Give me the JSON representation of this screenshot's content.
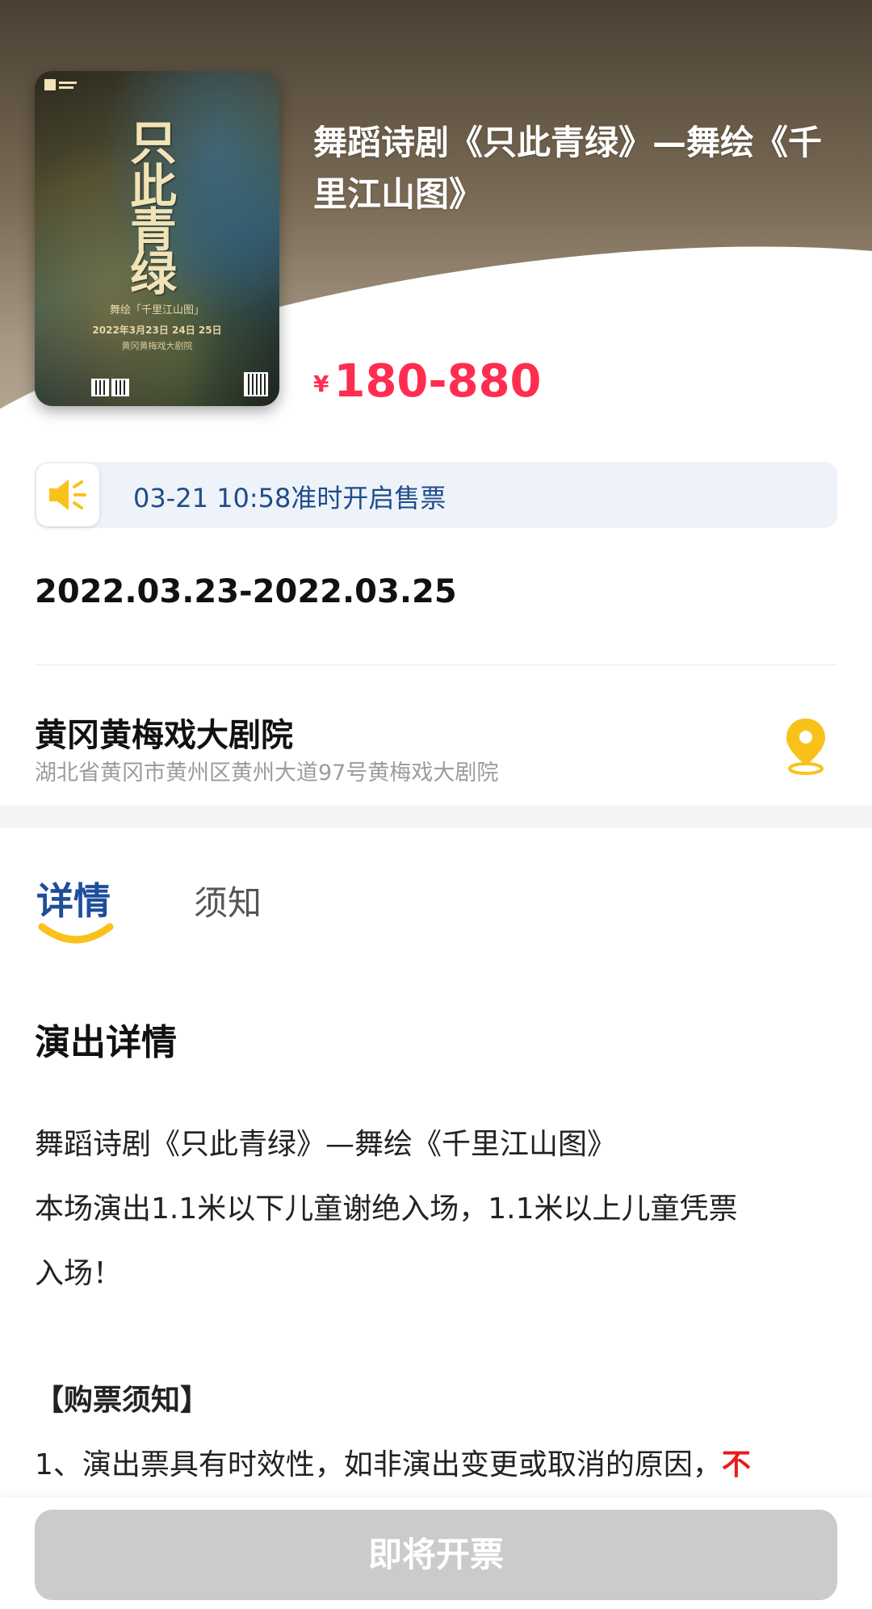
{
  "show": {
    "title": "舞蹈诗剧《只此青绿》—舞绘《千里江山图》",
    "price_currency": "¥",
    "price_range": "180-880"
  },
  "poster": {
    "title_text": "只此青绿",
    "subtitle": "舞绘「千里江山图」",
    "date_text": "2022年3月23日 24日 25日",
    "venue_text": "黄冈黄梅戏大剧院"
  },
  "notice": {
    "text": "03-21 10:58准时开启售票",
    "icon": "speaker-icon"
  },
  "schedule": {
    "date_range": "2022.03.23-2022.03.25"
  },
  "venue": {
    "name": "黄冈黄梅戏大剧院",
    "address": "湖北省黄冈市黄州区黄州大道97号黄梅戏大剧院",
    "icon": "location-pin-icon"
  },
  "tabs": [
    {
      "label": "详情",
      "active": true
    },
    {
      "label": "须知",
      "active": false
    }
  ],
  "detail": {
    "heading": "演出详情",
    "paragraphs": [
      "舞蹈诗剧《只此青绿》—舞绘《千里江山图》",
      "本场演出1.1米以下儿童谢绝入场，1.1米以上儿童凭票",
      "入场！"
    ],
    "purchase_heading": "【购票须知】",
    "purchase_line_1": "1、演出票具有时效性，如非演出变更或取消的原因，",
    "purchase_line_1_emphasis": "不"
  },
  "bottom": {
    "button_label": "即将开票"
  },
  "colors": {
    "price": "#ff2d4f",
    "accent_blue": "#1d4e9a",
    "accent_yellow": "#f9c21b",
    "button_disabled": "#cbcbcb"
  }
}
